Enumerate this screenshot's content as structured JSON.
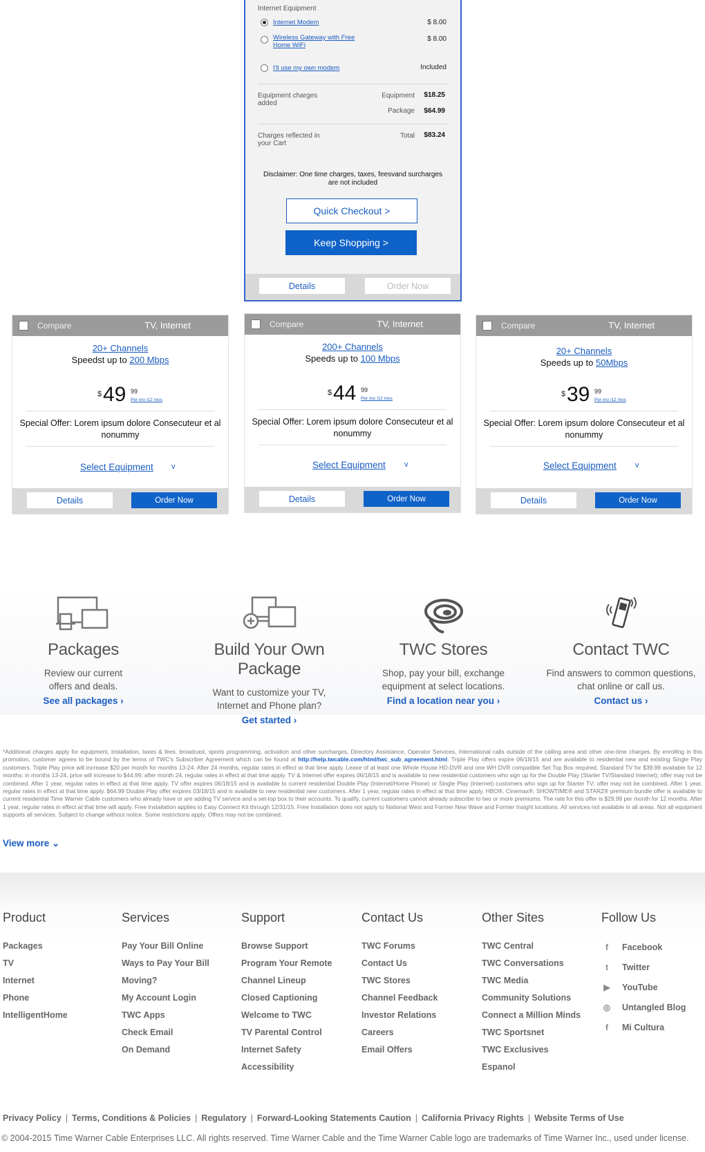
{
  "expanded_card": {
    "section_label": "Internet Equipment",
    "options": [
      {
        "label": "Internet Modem",
        "label_line2": "",
        "price": "$ 8.00",
        "selected": true
      },
      {
        "label": "Wireless Gateway with Free",
        "label_line2": "Home WiFi",
        "price": "$ 8.00",
        "selected": false
      },
      {
        "label": "I'll use my own modem",
        "label_line2": "",
        "price": "Included",
        "selected": false
      }
    ],
    "equipment_charges_label": "Equipment charges added",
    "equipment_label": "Equipment",
    "equipment_value": "$18.25",
    "package_label": "Package",
    "package_value": "$64.99",
    "reflected_label": "Charges reflected in your Cart",
    "total_label": "Total",
    "total_value": "$83.24",
    "disclaimer": "Disclaimer: One time charges, taxes, feesvand surcharges are not included",
    "quick_checkout": "Quick Checkout >",
    "keep_shopping": "Keep Shopping >",
    "details": "Details",
    "order_now": "Order Now"
  },
  "packages": [
    {
      "compare": "Compare",
      "type": "TV, Internet",
      "channels": "20+ Channels",
      "speed_prefix": "Speedst up to ",
      "speed": "200 Mbps",
      "dollar": "$",
      "price": "49",
      "cents": "99",
      "per": "Per mo /12 mos",
      "offer": "Special Offer: Lorem ipsum dolore Consecuteur et al nonummy",
      "select": "Select Equipment",
      "chevron": "v",
      "details": "Details",
      "order": "Order Now"
    },
    {
      "compare": "Compare",
      "type": "TV, Internet",
      "channels": "200+ Channels",
      "speed_prefix": "Speeds up to ",
      "speed": "100 Mbps",
      "dollar": "$",
      "price": "44",
      "cents": "99",
      "per": "Per mo /12 mos",
      "offer": "Special Offer: Lorem ipsum dolore Consecuteur et al nonummy",
      "select": "Select Equipment",
      "chevron": "v",
      "details": "Details",
      "order": "Order Now"
    },
    {
      "compare": "Compare",
      "type": "TV, Internet",
      "channels": "20+ Channels",
      "speed_prefix": "Speeds up to ",
      "speed": "50Mbps",
      "dollar": "$",
      "price": "39",
      "cents": "99",
      "per": "Per mo /12 mos",
      "offer": "Special Offer: Lorem ipsum dolore Consecuteur et al nonummy",
      "select": "Select Equipment",
      "chevron": "v",
      "details": "Details",
      "order": "Order Now"
    }
  ],
  "promo": [
    {
      "icon": "devices-icon",
      "title": "Packages",
      "desc": "Review our current offers and deals.",
      "link": "See all packages ›"
    },
    {
      "icon": "build-package-icon",
      "title": "Build Your Own Package",
      "desc": "Want to customize your TV, Internet and Phone plan?",
      "link": "Get started ›"
    },
    {
      "icon": "twc-logo-icon",
      "title": "TWC Stores",
      "desc": "Shop, pay your bill, exchange equipment at select locations.",
      "link": "Find a location near you ›"
    },
    {
      "icon": "phone-ringing-icon",
      "title": "Contact TWC",
      "desc": "Find answers to common questions, chat online or call us.",
      "link": "Contact us ›"
    }
  ],
  "legal": {
    "text_before_link": "*Additional charges apply for equipment, installation, taxes & fees, broadcast, sports programming, activation and other surcharges, Directory Assistance, Operator Services, International calls outside of the calling area and other one-time charges. By enrolling in this promotion, customer agrees to be bound by the terms of TWC's Subscriber Agreement which can be found at ",
    "link": "http://help.twcable.com/html/twc_sub_agreement.html",
    "text_after_link": ". Triple Play offers expire 06/18/15 and are available to residential new and existing Single Play customers. Triple Play price will increase $20 per month for months 13-24. After 24 months, regular rates in effect at that time apply. Lease of at least one Whole House HD-DVR and one WH DVR compatible Set Top Box required. Standard TV for $39.99 available for 12 months; in months 13-24, price will increase to $44.99; after month 24, regular rates in effect at that time apply. TV & Internet offer expires 06/18/15 and is available to new residential customers who sign up for the Double Play (Starter TV/Standard Internet); offer may not be combined. After 1 year, regular rates in effect at that time apply. TV offer expires 06/18/15 and is available to current residential Double Play (Internet/Home Phone) or Single Play (Internet) customers who sign up for Starter TV; offer may not be combined. After 1 year, regular rates in effect at that time apply. $64.99 Double Play offer expires 03/18/15 and is available to new residential new customers. After 1 year, regular rates in effect at that time apply. HBO®, Cinemax®, SHOWTIME® and STARZ® premium bundle offer is available to current residential Time Warner Cable customers who already have or are adding TV service and a set-top box to their accounts. To qualify, current customers cannot already subscribe to two or more premiums. The rate for this offer is $29.99 per month for 12 months. After 1 year, regular rates in effect at that time will apply. Free Installation applies to Easy Connect Kit through 12/31/15. Free Installation does not apply to National West and Former New Wave and Former Insight locations. All services not available in all areas. Not all equipment supports all services. Subject to change without notice. Some restrictions apply. Offers may not be combined.",
    "view_more": "View more ⌄"
  },
  "footer": {
    "columns": [
      {
        "title": "Product",
        "items": [
          "Packages",
          "TV",
          "Internet",
          "Phone",
          "IntelligentHome"
        ]
      },
      {
        "title": "Services",
        "items": [
          "Pay Your Bill Online",
          "Ways to Pay Your Bill",
          "Moving?",
          "My Account Login",
          "TWC Apps",
          "Check Email",
          "On Demand"
        ]
      },
      {
        "title": "Support",
        "items": [
          "Browse Support",
          "Program Your Remote",
          "Channel Lineup",
          "Closed Captioning",
          "Welcome to TWC",
          "TV Parental Control",
          "Internet Safety",
          "Accessibility"
        ]
      },
      {
        "title": "Contact Us",
        "items": [
          "TWC Forums",
          "Contact Us",
          "TWC Stores",
          "Channel Feedback",
          "Investor Relations",
          "Careers",
          "Email Offers"
        ]
      },
      {
        "title": "Other Sites",
        "items": [
          "TWC Central",
          "TWC Conversations",
          "TWC Media",
          "Community Solutions",
          "Connect a Million Minds",
          "TWC Sportsnet",
          "TWC Exclusives",
          "Espanol"
        ]
      }
    ],
    "follow": {
      "title": "Follow Us",
      "items": [
        {
          "icon": "facebook-icon",
          "glyph": "f",
          "label": "Facebook"
        },
        {
          "icon": "twitter-icon",
          "glyph": "t",
          "label": "Twitter"
        },
        {
          "icon": "youtube-icon",
          "glyph": "▶",
          "label": "YouTube"
        },
        {
          "icon": "blog-icon",
          "glyph": "◎",
          "label": "Untangled Blog"
        },
        {
          "icon": "micultura-facebook-icon",
          "glyph": "f",
          "label": "Mi Cultura"
        }
      ]
    },
    "legal_links": [
      "Privacy Policy",
      "Terms, Conditions & Policies",
      "Regulatory",
      "Forward-Looking Statements Caution",
      "California Privacy Rights",
      "Website Terms of Use"
    ],
    "copyright": "© 2004-2015 Time Warner Cable Enterprises LLC. All rights reserved. Time Warner Cable and the Time Warner Cable logo are trademarks of Time Warner Inc., used under license."
  }
}
